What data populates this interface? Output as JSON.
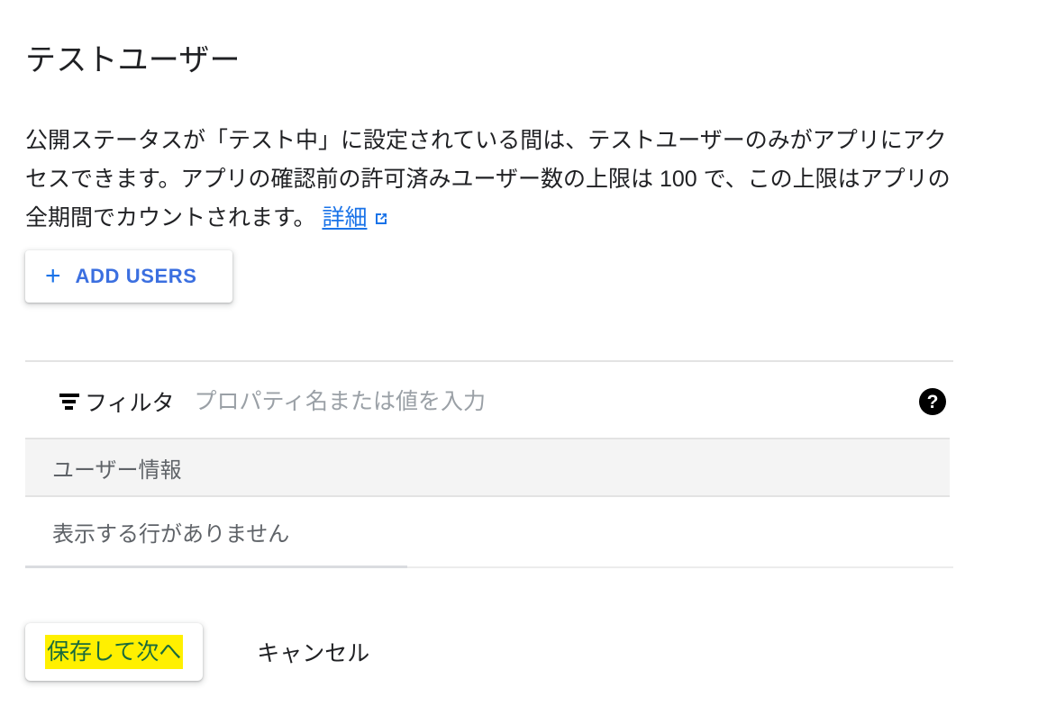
{
  "page": {
    "title": "テストユーザー",
    "description": {
      "text": "公開ステータスが「テスト中」に設定されている間は、テストユーザーのみがアプリにアクセスできます。アプリの確認前の許可済みユーザー数の上限は 100 で、この上限はアプリの全期間でカウントされます。 ",
      "link_label": "詳細",
      "link_icon": "external-link-icon",
      "user_limit": "100"
    }
  },
  "actions": {
    "add_users_label": "ADD USERS",
    "add_users_icon": "plus-icon"
  },
  "filter": {
    "icon": "filter-icon",
    "label": "フィルタ",
    "value": "",
    "placeholder": "プロパティ名または値を入力",
    "help_icon": "help-circle-icon",
    "help_glyph": "?"
  },
  "table": {
    "columns": [
      "ユーザー情報"
    ],
    "rows": [],
    "empty_message": "表示する行がありません"
  },
  "footer": {
    "save_label": "保存して次へ",
    "cancel_label": "キャンセル"
  },
  "colors": {
    "accent_blue": "#1a73e8",
    "link_blue": "#1a73e8",
    "button_text_blue": "#3b6fe0",
    "highlight_yellow": "#fff000",
    "highlight_text_green": "#1a6b3c",
    "text_primary": "#202124",
    "text_secondary": "#5f6368",
    "placeholder_gray": "#9aa0a6",
    "divider_gray": "#e3e3e3",
    "table_header_bg": "#f4f4f4",
    "background": "#ffffff"
  }
}
